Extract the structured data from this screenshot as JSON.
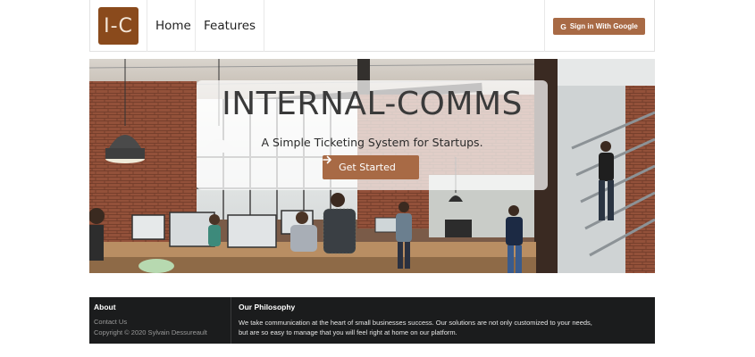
{
  "navbar": {
    "logo_text": "I-C",
    "items": [
      {
        "label": "Home"
      },
      {
        "label": "Features"
      }
    ],
    "signin_label": "Sign in With Google",
    "signin_icon": "G"
  },
  "hero": {
    "title": "INTERNAL-COMMS",
    "subtitle": "A Simple Ticketing System for Startups.",
    "cta_label": "Get Started",
    "cta_icon": "arrow-right-icon"
  },
  "footer": {
    "about_heading": "About",
    "contact_link": "Contact Us",
    "copyright": "Copyright © 2020 Sylvain Dessureault",
    "philosophy_heading": "Our Philosophy",
    "philosophy_text": "We take communication at the heart of small businesses success. Our solutions are not only customized to your needs, but are so easy to manage that you will feel right at home on our platform."
  },
  "colors": {
    "accent": "#a86a45",
    "logo_bg": "#8a4a1c",
    "footer_bg": "#1b1c1d"
  }
}
